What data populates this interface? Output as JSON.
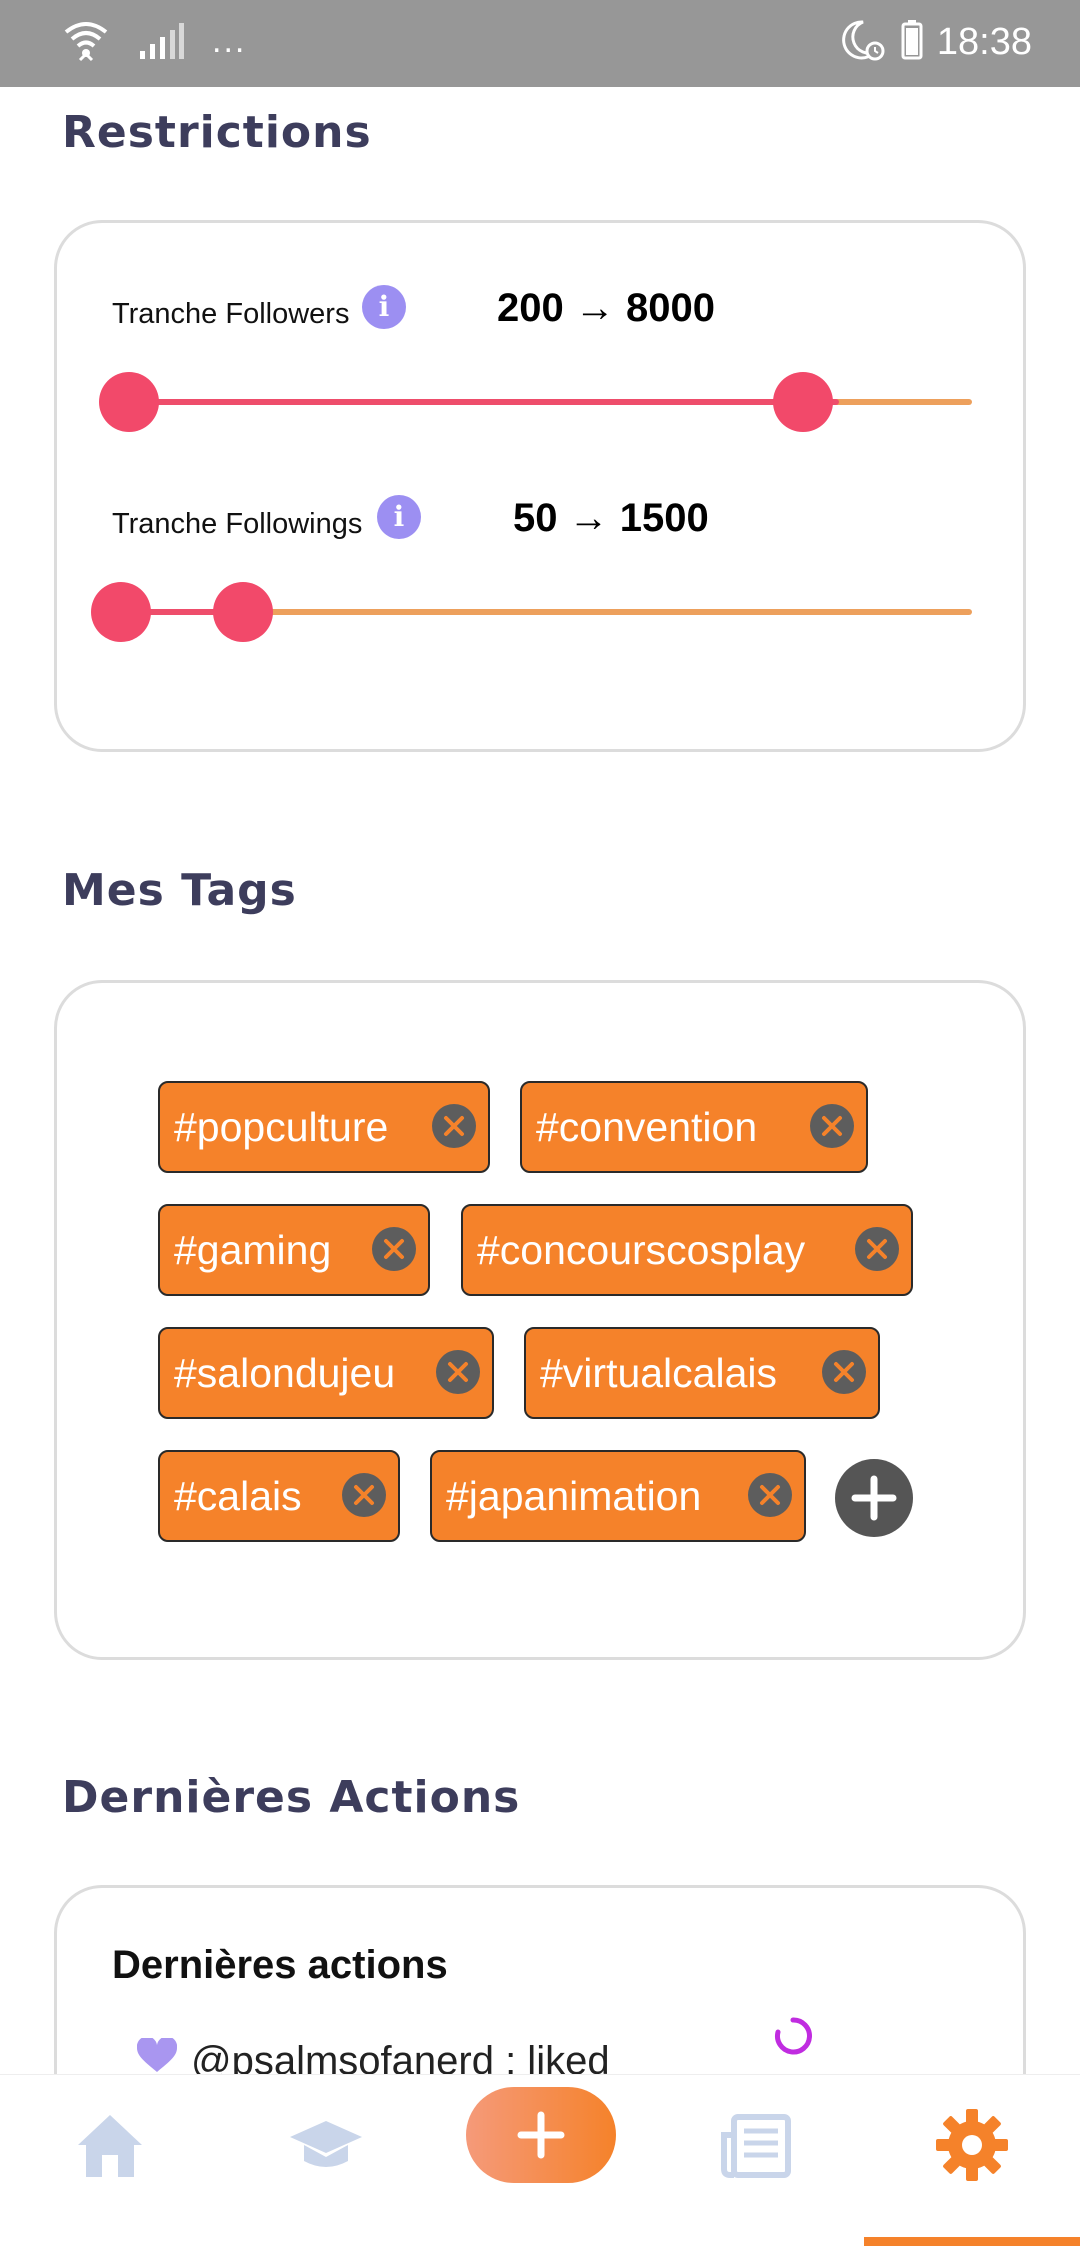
{
  "status_bar": {
    "time": "18:38",
    "overflow": "..."
  },
  "restrictions": {
    "title": "Restrictions",
    "followers": {
      "label": "Tranche Followers",
      "value_text": "200 → 8000",
      "low": 200,
      "high": 8000
    },
    "followings": {
      "label": "Tranche Followings",
      "value_text": "50 → 1500",
      "low": 50,
      "high": 1500
    }
  },
  "tags": {
    "title": "Mes Tags",
    "items": [
      "#popculture",
      "#convention",
      "#gaming",
      "#concourscosplay",
      "#salondujeu",
      "#virtualcalais",
      "#calais",
      "#japanimation"
    ]
  },
  "actions": {
    "title": "Dernières Actions",
    "card_title": "Dernières actions",
    "rows": [
      {
        "text": "@psalmsofanerd : liked",
        "icon": "heart-icon"
      }
    ]
  },
  "bottom_nav": {
    "items": [
      "home-icon",
      "graduation-cap-icon",
      "add-icon",
      "newspaper-icon",
      "settings-icon"
    ],
    "active": "settings-icon"
  },
  "colors": {
    "accent": "#f5822a",
    "slider_thumb": "#f2496a",
    "slider_track": "#eda05c",
    "info": "#9c8ff2",
    "title": "#3d3d5c"
  }
}
